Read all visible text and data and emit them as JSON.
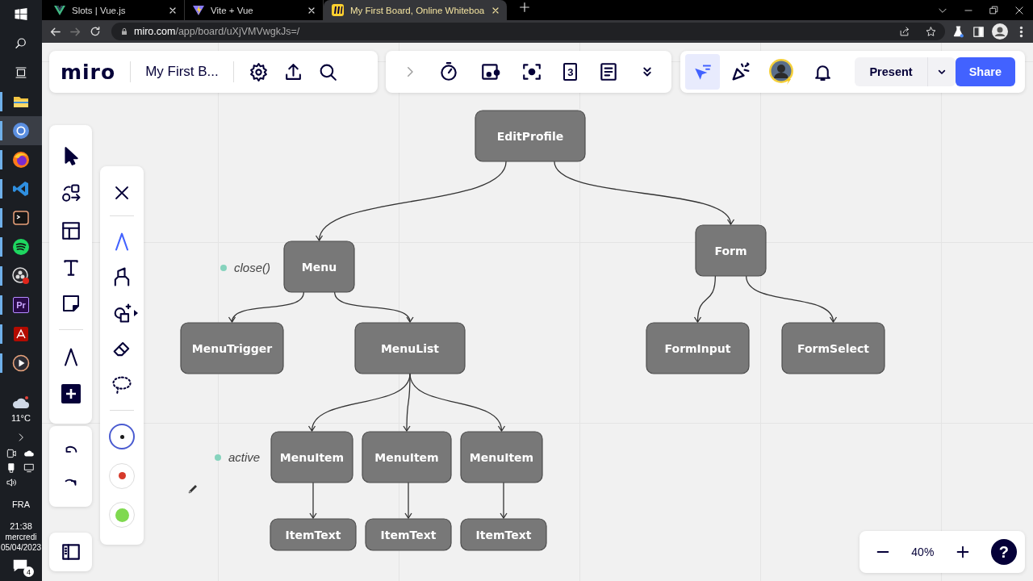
{
  "taskbar": {
    "apps": [
      {
        "kind": "explorer",
        "running": true,
        "selected": false
      },
      {
        "kind": "chrome",
        "running": true,
        "selected": true
      },
      {
        "kind": "firefox",
        "running": true,
        "selected": false
      },
      {
        "kind": "vscode",
        "running": true,
        "selected": false
      },
      {
        "kind": "terminal",
        "running": true,
        "selected": false
      },
      {
        "kind": "spotify",
        "running": true,
        "selected": false
      },
      {
        "kind": "obs",
        "running": true,
        "selected": false
      },
      {
        "kind": "premiere",
        "label": "Pr",
        "running": true,
        "selected": false
      },
      {
        "kind": "acrobat",
        "running": true,
        "selected": false
      },
      {
        "kind": "player",
        "running": true,
        "selected": false
      }
    ],
    "weather": "11°C",
    "language": "FRA",
    "time": "21:38",
    "day": "mercredi",
    "date": "05/04/2023",
    "notifications": "4"
  },
  "browser": {
    "tabs": [
      {
        "title": "Slots | Vue.js",
        "kind": "vue",
        "selected": false
      },
      {
        "title": "Vite + Vue",
        "kind": "vite",
        "selected": false
      },
      {
        "title": "My First Board, Online Whiteboa",
        "kind": "miro",
        "selected": true
      }
    ],
    "url_host": "miro.com",
    "url_path": "/app/board/uXjVMVwgkJs=/"
  },
  "board": {
    "logo": "miro",
    "title": "My First B...",
    "collab_tools": [
      {
        "kind": "timer"
      },
      {
        "kind": "voting"
      },
      {
        "kind": "focus"
      },
      {
        "kind": "cards",
        "label": "3"
      },
      {
        "kind": "notes"
      }
    ],
    "cursor_toggle": {
      "selected": true
    },
    "present": "Present",
    "share": "Share",
    "pen_tools": [
      {
        "kind": "pen",
        "selected": true
      },
      {
        "kind": "highlighter",
        "selected": false
      },
      {
        "kind": "smart_shape",
        "selected": false
      },
      {
        "kind": "eraser",
        "selected": false
      },
      {
        "kind": "lasso",
        "selected": false
      }
    ],
    "pen_colors": [
      {
        "color": "#1a1a1a",
        "selected": true
      },
      {
        "color": "#d63a2b",
        "selected": false
      },
      {
        "color": "#7fd94f",
        "selected": false
      }
    ],
    "zoom": "40%",
    "help": "?"
  },
  "diagram": {
    "tree": {
      "label": "EditProfile",
      "children": [
        {
          "label": "Menu",
          "children": [
            {
              "label": "MenuTrigger"
            },
            {
              "label": "MenuList",
              "children": [
                {
                  "label": "MenuItem",
                  "children": [
                    {
                      "label": "ItemText"
                    }
                  ]
                },
                {
                  "label": "MenuItem",
                  "children": [
                    {
                      "label": "ItemText"
                    }
                  ]
                },
                {
                  "label": "MenuItem",
                  "children": [
                    {
                      "label": "ItemText"
                    }
                  ]
                }
              ]
            }
          ]
        },
        {
          "label": "Form",
          "children": [
            {
              "label": "FormInput"
            },
            {
              "label": "FormSelect"
            }
          ]
        }
      ]
    },
    "notes": [
      {
        "text": "close()"
      },
      {
        "text": "active"
      }
    ]
  }
}
